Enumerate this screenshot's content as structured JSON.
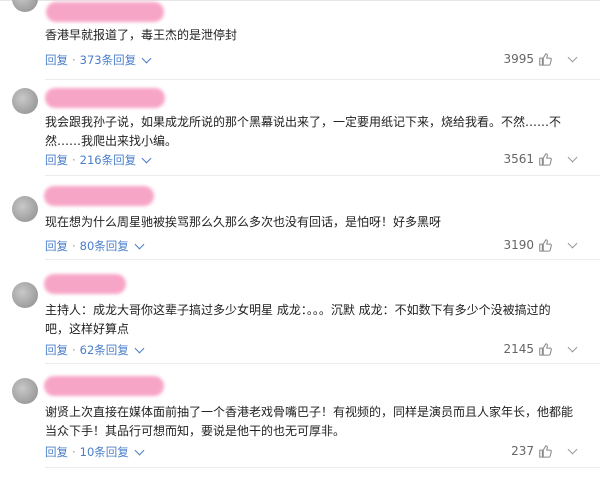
{
  "comments": [
    {
      "text_lines": [
        "香港早就报道了，毒王杰的是泄停封"
      ],
      "reply_label": "回复",
      "separator": "·",
      "replies_label": "373条回复",
      "likes": "3995"
    },
    {
      "text_lines": [
        "我会跟我孙子说，如果成龙所说的那个黑幕说出来了，一定要用纸记下来，烧给我看。不然……不",
        "然……我爬出来找小编。"
      ],
      "reply_label": "回复",
      "separator": "·",
      "replies_label": "216条回复",
      "likes": "3561"
    },
    {
      "text_lines": [
        "现在想为什么周星驰被挨骂那么久那么多次也没有回话，是怕呀！好多黑呀"
      ],
      "reply_label": "回复",
      "separator": "·",
      "replies_label": "80条回复",
      "likes": "3190"
    },
    {
      "text_lines": [
        "主持人：成龙大哥你这辈子搞过多少女明星 成龙：。。。沉默 成龙：不如数下有多少个没被搞过的",
        "吧，这样好算点"
      ],
      "reply_label": "回复",
      "separator": "·",
      "replies_label": "62条回复",
      "likes": "2145"
    },
    {
      "text_lines": [
        "谢贤上次直接在媒体面前抽了一个香港老戏骨嘴巴子！有视频的，同样是演员而且人家年长，他都能",
        "当众下手！其品行可想而知，要说是他干的也无可厚非。"
      ],
      "reply_label": "回复",
      "separator": "·",
      "replies_label": "10条回复",
      "likes": "237"
    }
  ],
  "colors": {
    "link": "#4a7ec9",
    "name_redaction": "#f7a1c4",
    "text": "#222222",
    "likes": "#666666"
  }
}
